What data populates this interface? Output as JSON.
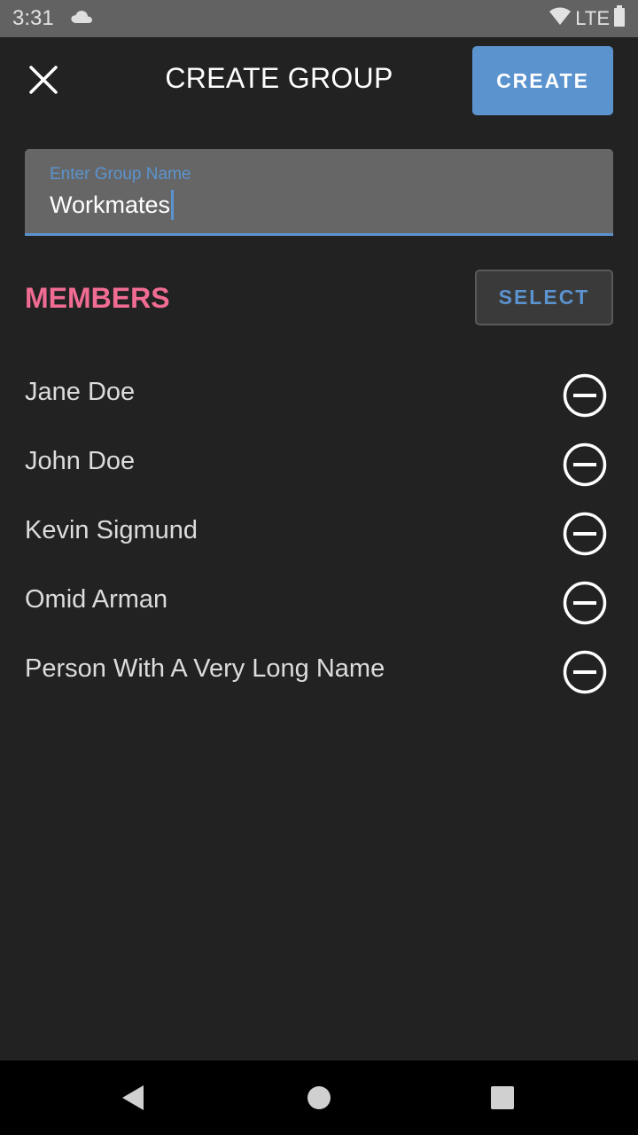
{
  "status_bar": {
    "time": "3:31",
    "network": "LTE",
    "icons": [
      "cloud-icon",
      "wifi-icon",
      "battery-icon"
    ]
  },
  "toolbar": {
    "close_icon": "close-icon",
    "title": "CREATE GROUP",
    "create_label": "CREATE"
  },
  "group_name": {
    "label": "Enter Group Name",
    "value": "Workmates"
  },
  "members": {
    "heading": "MEMBERS",
    "select_label": "SELECT",
    "items": [
      {
        "name": "Jane Doe"
      },
      {
        "name": "John Doe"
      },
      {
        "name": "Kevin Sigmund"
      },
      {
        "name": "Omid Arman"
      },
      {
        "name": "Person With A Very Long Name"
      }
    ]
  },
  "nav_bar": {
    "icons": [
      "back-icon",
      "home-icon",
      "recents-icon"
    ]
  },
  "colors": {
    "accent": "#5b93cf",
    "members_heading": "#f06c93",
    "background": "#222222",
    "status_bar": "#626262"
  }
}
